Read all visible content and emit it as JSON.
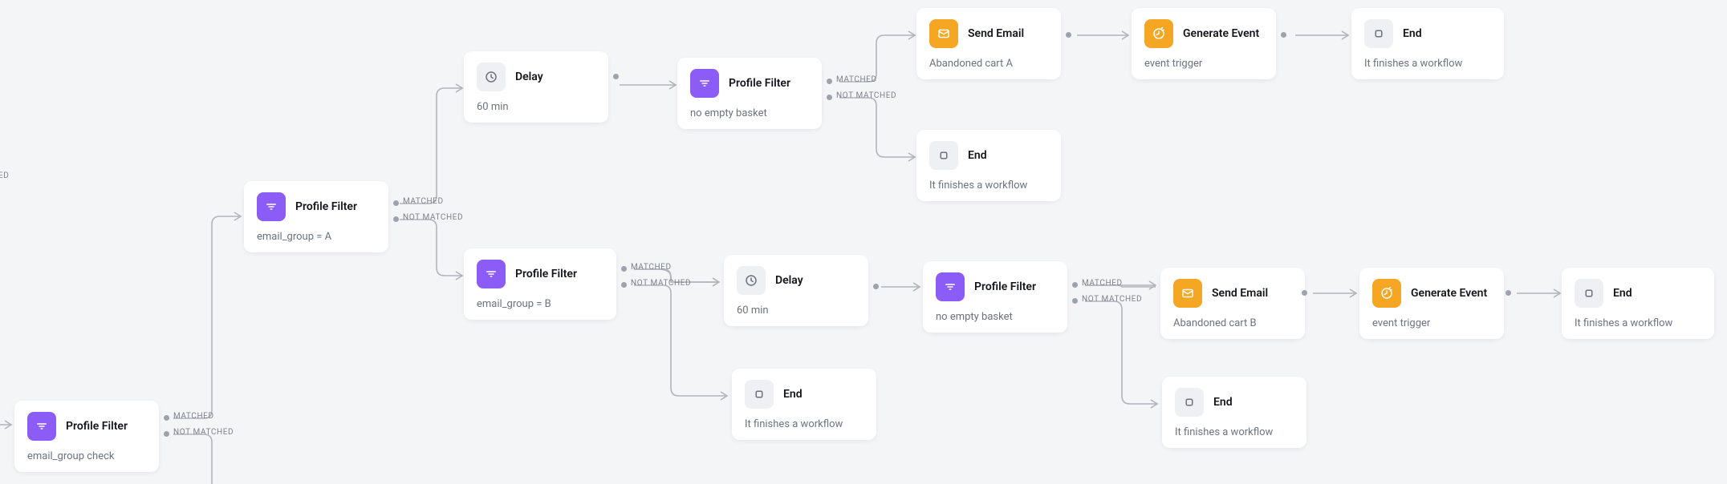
{
  "labels": {
    "matched": "MATCHED",
    "not_matched": "NOT MATCHED",
    "ed_fragment": "ED"
  },
  "nodes": {
    "filter_root": {
      "title": "Profile Filter",
      "sub": "email_group check"
    },
    "filter_a": {
      "title": "Profile Filter",
      "sub": "email_group = A"
    },
    "delay_a": {
      "title": "Delay",
      "sub": "60 min"
    },
    "filter_basket_a": {
      "title": "Profile Filter",
      "sub": "no empty basket"
    },
    "email_a": {
      "title": "Send Email",
      "sub": "Abandoned cart A"
    },
    "event_a": {
      "title": "Generate Event",
      "sub": "event trigger"
    },
    "end_a": {
      "title": "End",
      "sub": "It finishes a workflow"
    },
    "end_basket_a": {
      "title": "End",
      "sub": "It finishes a workflow"
    },
    "filter_b": {
      "title": "Profile Filter",
      "sub": "email_group = B"
    },
    "delay_b": {
      "title": "Delay",
      "sub": "60 min"
    },
    "end_filter_b": {
      "title": "End",
      "sub": "It finishes a workflow"
    },
    "filter_basket_b": {
      "title": "Profile Filter",
      "sub": "no empty basket"
    },
    "email_b": {
      "title": "Send Email",
      "sub": "Abandoned cart B"
    },
    "end_basket_b": {
      "title": "End",
      "sub": "It finishes a workflow"
    },
    "event_b": {
      "title": "Generate Event",
      "sub": "event trigger"
    },
    "end_b": {
      "title": "End",
      "sub": "It finishes a workflow"
    }
  }
}
